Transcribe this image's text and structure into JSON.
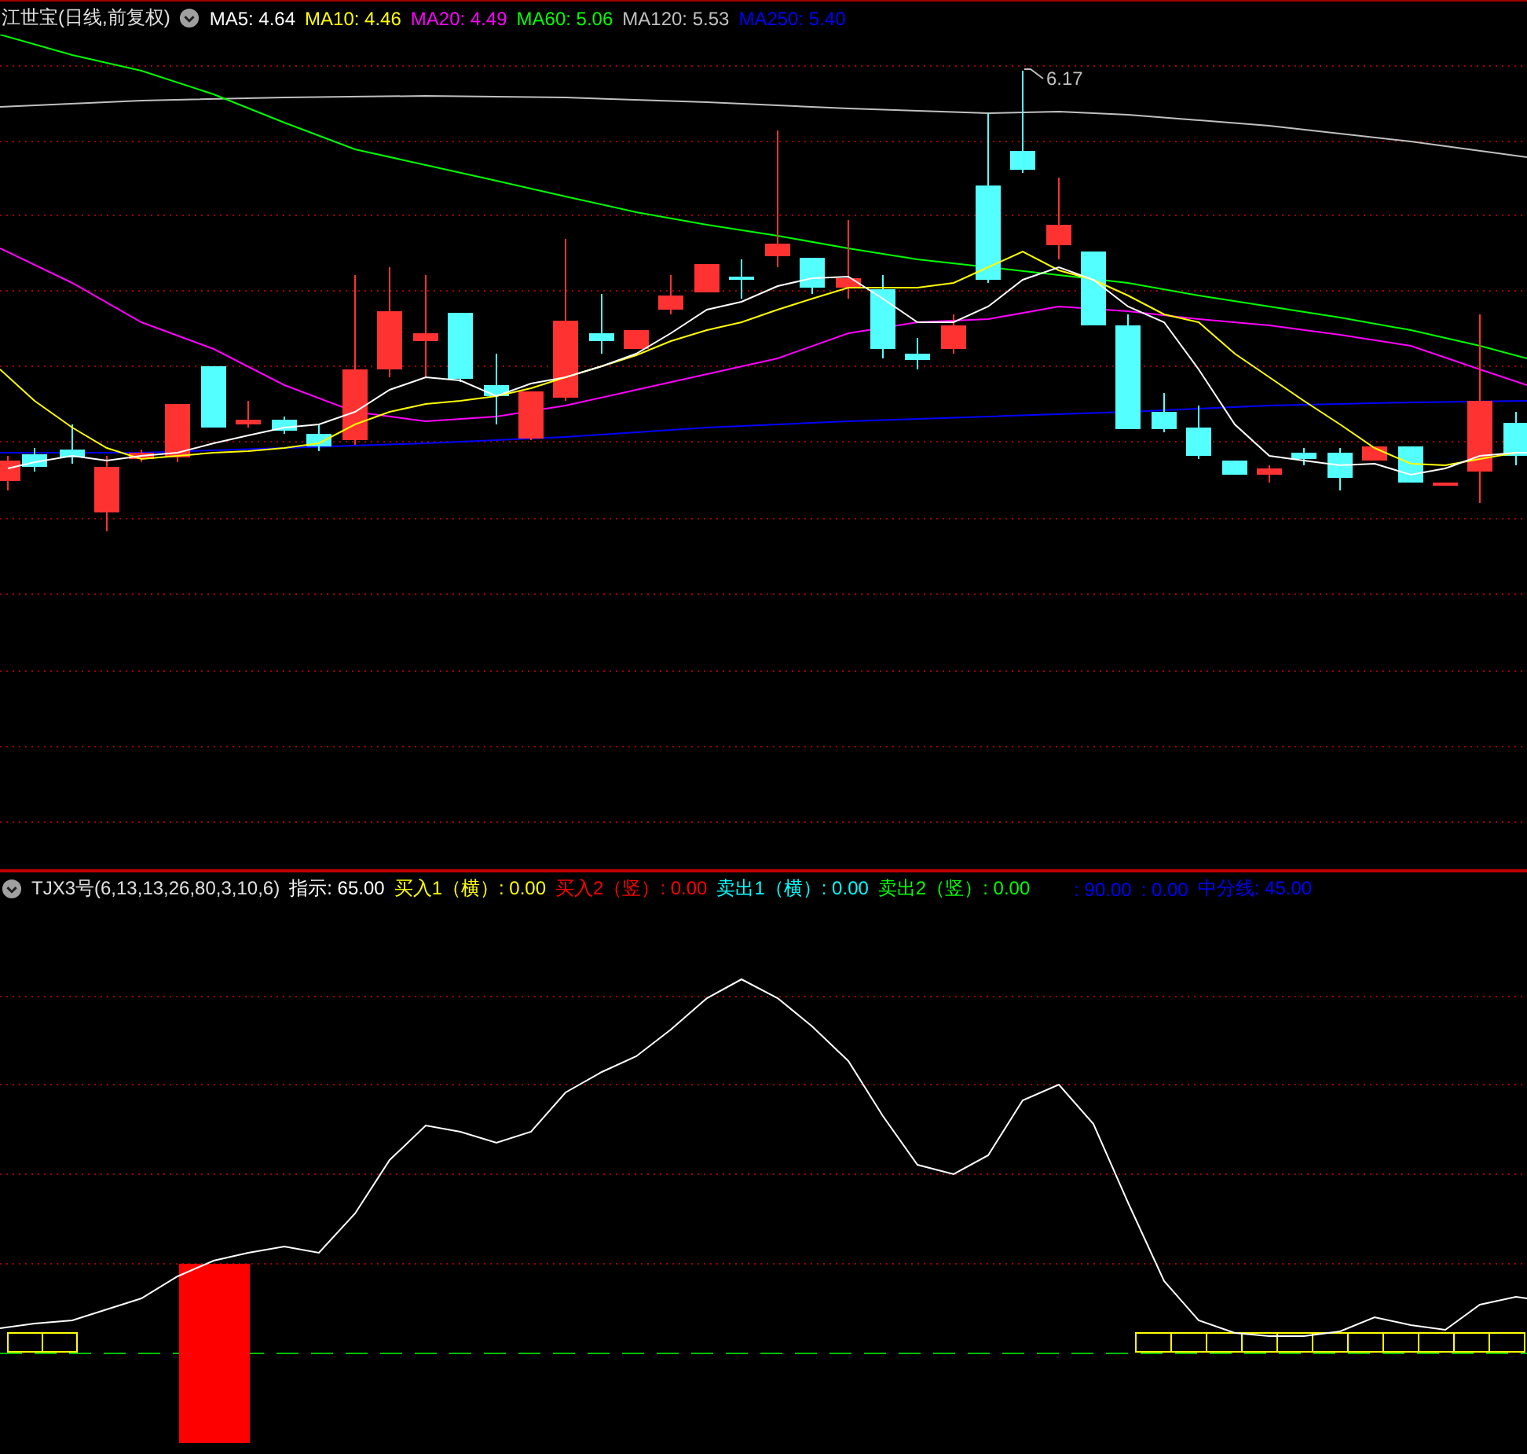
{
  "price_panel": {
    "title": "江世宝(日线,前复权)",
    "indicators": [
      {
        "text": "MA5: 4.64",
        "color": "#ffffff"
      },
      {
        "text": "MA10: 4.46",
        "color": "#ffff00"
      },
      {
        "text": "MA20: 4.49",
        "color": "#ff00ff"
      },
      {
        "text": "MA60: 5.06",
        "color": "#00ff00"
      },
      {
        "text": "MA120: 5.53",
        "color": "#c0c0c0"
      },
      {
        "text": "MA250: 5.40",
        "color": "#0000ff"
      }
    ],
    "high_label": "6.17"
  },
  "indicator_panel": {
    "title": "TJX3号(6,13,13,26,80,3,10,6)",
    "indicators": [
      {
        "text": "指示: 65.00",
        "color": "#ffffff"
      },
      {
        "text": "买入1（横）: 0.00",
        "color": "#ffff00"
      },
      {
        "text": "买入2（竖）: 0.00",
        "color": "#ff0000"
      },
      {
        "text": "卖出1（横）: 0.00",
        "color": "#00ffff"
      },
      {
        "text": "卖出2（竖）: 0.00",
        "color": "#00ff00"
      },
      {
        "text": ": 90.00",
        "color": "#0000ff"
      },
      {
        "text": ": 0.00",
        "color": "#0000ff"
      },
      {
        "text": "中分线: 45.00",
        "color": "#0000ff"
      }
    ]
  }
}
